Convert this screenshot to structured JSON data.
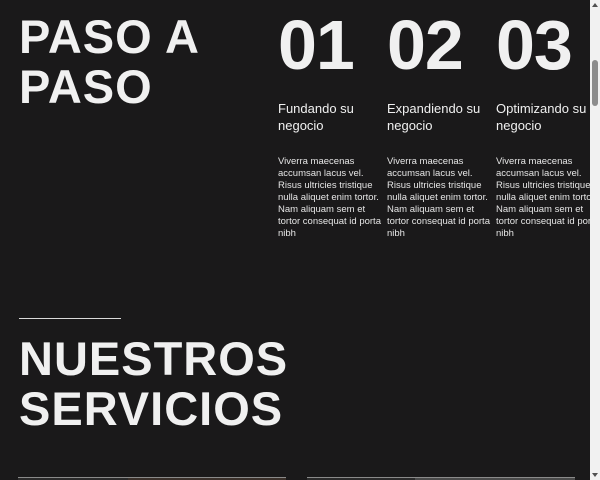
{
  "process": {
    "heading": "PASO A PASO",
    "steps": [
      {
        "number": "01",
        "title": "Fundando su negocio",
        "text": "Viverra maecenas accumsan lacus vel. Risus ultricies tristique nulla aliquet enim tortor. Nam aliquam sem et tortor consequat id porta nibh"
      },
      {
        "number": "02",
        "title": "Expandiendo su negocio",
        "text": "Viverra maecenas accumsan lacus vel. Risus ultricies tristique nulla aliquet enim tortor. Nam aliquam sem et tortor consequat id porta nibh"
      },
      {
        "number": "03",
        "title": "Optimizando su negocio",
        "text": "Viverra maecenas accumsan lacus vel. Risus ultricies tristique nulla aliquet enim tortor. Nam aliquam sem et tortor consequat id porta nibh"
      }
    ]
  },
  "services": {
    "heading": "NUESTROS SERVICIOS"
  },
  "colors": {
    "background": "#1a191a",
    "text": "#f0f0f0",
    "scrollbar_track": "#f1f1f1",
    "scrollbar_thumb": "#8c8c8c"
  }
}
